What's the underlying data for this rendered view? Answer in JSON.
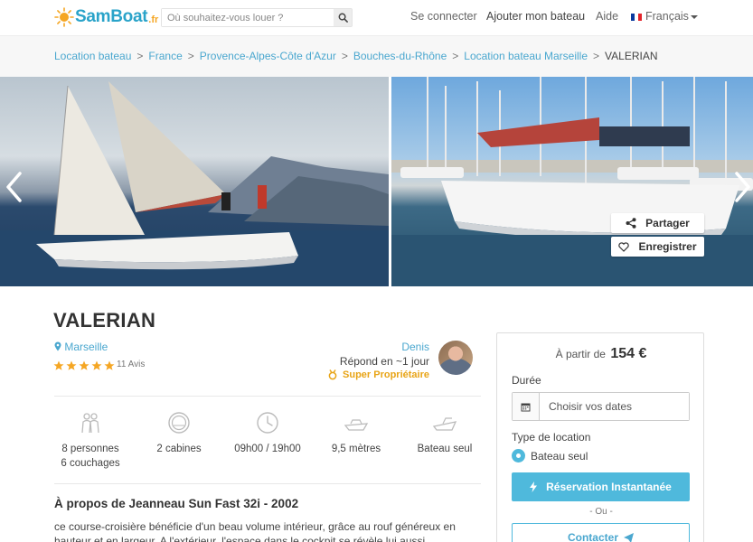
{
  "header": {
    "logo_text": "SamBoat",
    "logo_tld": ".fr",
    "search_placeholder": "Où souhaitez-vous louer ?",
    "login": "Se connecter",
    "add_boat": "Ajouter mon bateau",
    "help": "Aide",
    "language": "Français"
  },
  "breadcrumb": {
    "items": [
      "Location bateau",
      "France",
      "Provence-Alpes-Côte d'Azur",
      "Bouches-du-Rhône",
      "Location bateau Marseille"
    ],
    "current": "VALERIAN"
  },
  "photos": {
    "share_label": "Partager",
    "save_label": "Enregistrer"
  },
  "listing": {
    "title": "VALERIAN",
    "location": "Marseille",
    "rating_stars": 5,
    "reviews": "11 Avis"
  },
  "owner": {
    "name": "Denis",
    "response": "Répond en ~1 jour",
    "badge": "Super Propriétaire"
  },
  "features": [
    {
      "icon": "people-icon",
      "line1": "8 personnes",
      "line2": "6 couchages"
    },
    {
      "icon": "porthole-icon",
      "line1": "2 cabines",
      "line2": ""
    },
    {
      "icon": "clock-icon",
      "line1": "09h00 / 19h00",
      "line2": ""
    },
    {
      "icon": "boat-length-icon",
      "line1": "9,5 mètres",
      "line2": ""
    },
    {
      "icon": "boat-only-icon",
      "line1": "Bateau seul",
      "line2": ""
    }
  ],
  "about": {
    "title": "À propos de Jeanneau Sun Fast 32i - 2002",
    "text": "ce course-croisière bénéficie d'un beau volume intérieur, grâce au rouf généreux en hauteur et en largeur. A l'extérieur, l'espace dans le cockpit se révèle lui aussi satisfaisant."
  },
  "booking": {
    "from_label": "À partir de",
    "price": "154 €",
    "duration_label": "Durée",
    "date_placeholder": "Choisir vos dates",
    "rental_type_label": "Type de location",
    "rental_type_option": "Bateau seul",
    "instant_label": "Réservation Instantanée",
    "or_label": "- Ou -",
    "contact_label": "Contacter"
  },
  "colors": {
    "accent": "#4fb9dc",
    "link": "#4aa7cf",
    "star": "#f5a623",
    "badge": "#e8a416"
  }
}
